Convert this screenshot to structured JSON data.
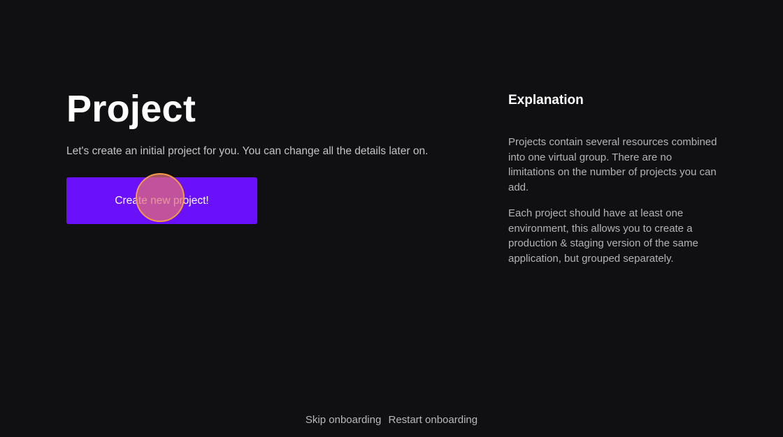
{
  "main": {
    "title": "Project",
    "subtitle": "Let's create an initial project for you. You can change all the details later on.",
    "create_button_label": "Create new project!"
  },
  "explanation": {
    "title": "Explanation",
    "paragraphs": [
      "Projects contain several resources combined into one virtual group. There are no limitations on the number of projects you can add.",
      "Each project should have at least one environment, this allows you to create a production & staging version of the same application, but grouped separately."
    ]
  },
  "footer": {
    "skip_label": "Skip onboarding",
    "restart_label": "Restart onboarding"
  },
  "colors": {
    "background": "#101012",
    "accent": "#6b10fb",
    "cursor_ring": "#f59a45"
  }
}
